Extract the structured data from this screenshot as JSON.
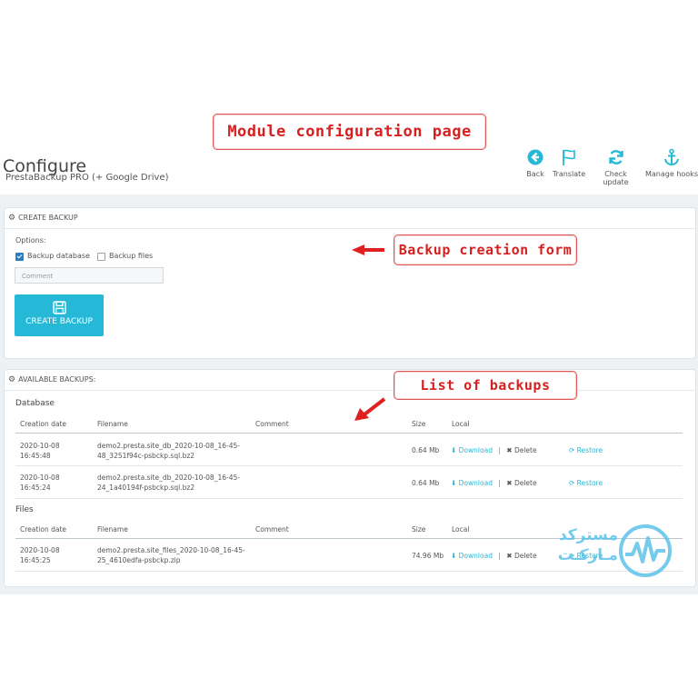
{
  "callouts": {
    "module_config": "Module configuration page",
    "backup_form": "Backup creation form",
    "list_backups": "List of backups"
  },
  "header": {
    "title": "Configure",
    "subtitle": "PrestaBackup PRO (+ Google Drive)"
  },
  "toolbar": {
    "back": "Back",
    "translate": "Translate",
    "check_update": "Check update",
    "manage_hooks": "Manage hooks"
  },
  "create_panel": {
    "heading": "CREATE BACKUP",
    "options_label": "Options:",
    "backup_database_label": "Backup database",
    "backup_database_checked": true,
    "backup_files_label": "Backup files",
    "backup_files_checked": false,
    "comment_placeholder": "Comment",
    "create_button": "CREATE BACKUP"
  },
  "backups_panel": {
    "heading": "AVAILABLE BACKUPS:",
    "columns": [
      "Creation date",
      "Filename",
      "Comment",
      "Size",
      "Local"
    ],
    "database": {
      "title": "Database",
      "rows": [
        {
          "date1": "2020-10-08",
          "date2": "16:45:48",
          "file1": "demo2.presta.site_db_2020-10-08_16-45-",
          "file2": "48_3251f94c-psbckp.sql.bz2",
          "comment": "",
          "size": "0.64 Mb"
        },
        {
          "date1": "2020-10-08",
          "date2": "16:45:24",
          "file1": "demo2.presta.site_db_2020-10-08_16-45-",
          "file2": "24_1a40194f-psbckp.sql.bz2",
          "comment": "",
          "size": "0.64 Mb"
        }
      ]
    },
    "files": {
      "title": "Files",
      "rows": [
        {
          "date1": "2020-10-08",
          "date2": "16:45:25",
          "file1": "demo2.presta.site_files_2020-10-08_16-45-",
          "file2": "25_4610edfa-psbckp.zip",
          "comment": "",
          "size": "74.96 Mb"
        }
      ]
    },
    "actions": {
      "download": "Download",
      "delete": "Delete",
      "restore": "Restore",
      "separator": "|"
    }
  },
  "watermark": {
    "line1": "مستركد",
    "line2": "مـارکـت"
  },
  "colors": {
    "accent": "#25b9d7",
    "callout_red": "#d61f1f",
    "checkbox_blue": "#2a7fc4",
    "bg_gray": "#eef1f4"
  }
}
